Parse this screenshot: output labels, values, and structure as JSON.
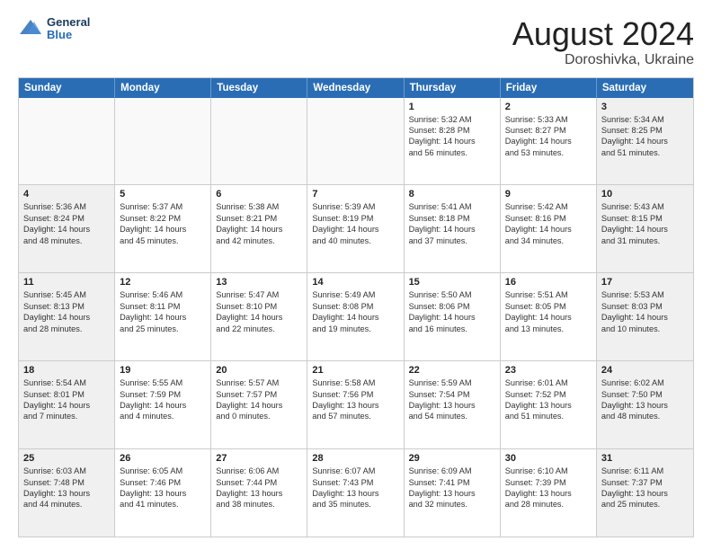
{
  "logo": {
    "text1": "General",
    "text2": "Blue"
  },
  "title": "August 2024",
  "subtitle": "Doroshivka, Ukraine",
  "header_days": [
    "Sunday",
    "Monday",
    "Tuesday",
    "Wednesday",
    "Thursday",
    "Friday",
    "Saturday"
  ],
  "rows": [
    [
      {
        "day": "",
        "lines": [],
        "empty": true
      },
      {
        "day": "",
        "lines": [],
        "empty": true
      },
      {
        "day": "",
        "lines": [],
        "empty": true
      },
      {
        "day": "",
        "lines": [],
        "empty": true
      },
      {
        "day": "1",
        "lines": [
          "Sunrise: 5:32 AM",
          "Sunset: 8:28 PM",
          "Daylight: 14 hours",
          "and 56 minutes."
        ],
        "empty": false
      },
      {
        "day": "2",
        "lines": [
          "Sunrise: 5:33 AM",
          "Sunset: 8:27 PM",
          "Daylight: 14 hours",
          "and 53 minutes."
        ],
        "empty": false
      },
      {
        "day": "3",
        "lines": [
          "Sunrise: 5:34 AM",
          "Sunset: 8:25 PM",
          "Daylight: 14 hours",
          "and 51 minutes."
        ],
        "empty": false
      }
    ],
    [
      {
        "day": "4",
        "lines": [
          "Sunrise: 5:36 AM",
          "Sunset: 8:24 PM",
          "Daylight: 14 hours",
          "and 48 minutes."
        ],
        "empty": false
      },
      {
        "day": "5",
        "lines": [
          "Sunrise: 5:37 AM",
          "Sunset: 8:22 PM",
          "Daylight: 14 hours",
          "and 45 minutes."
        ],
        "empty": false
      },
      {
        "day": "6",
        "lines": [
          "Sunrise: 5:38 AM",
          "Sunset: 8:21 PM",
          "Daylight: 14 hours",
          "and 42 minutes."
        ],
        "empty": false
      },
      {
        "day": "7",
        "lines": [
          "Sunrise: 5:39 AM",
          "Sunset: 8:19 PM",
          "Daylight: 14 hours",
          "and 40 minutes."
        ],
        "empty": false
      },
      {
        "day": "8",
        "lines": [
          "Sunrise: 5:41 AM",
          "Sunset: 8:18 PM",
          "Daylight: 14 hours",
          "and 37 minutes."
        ],
        "empty": false
      },
      {
        "day": "9",
        "lines": [
          "Sunrise: 5:42 AM",
          "Sunset: 8:16 PM",
          "Daylight: 14 hours",
          "and 34 minutes."
        ],
        "empty": false
      },
      {
        "day": "10",
        "lines": [
          "Sunrise: 5:43 AM",
          "Sunset: 8:15 PM",
          "Daylight: 14 hours",
          "and 31 minutes."
        ],
        "empty": false
      }
    ],
    [
      {
        "day": "11",
        "lines": [
          "Sunrise: 5:45 AM",
          "Sunset: 8:13 PM",
          "Daylight: 14 hours",
          "and 28 minutes."
        ],
        "empty": false
      },
      {
        "day": "12",
        "lines": [
          "Sunrise: 5:46 AM",
          "Sunset: 8:11 PM",
          "Daylight: 14 hours",
          "and 25 minutes."
        ],
        "empty": false
      },
      {
        "day": "13",
        "lines": [
          "Sunrise: 5:47 AM",
          "Sunset: 8:10 PM",
          "Daylight: 14 hours",
          "and 22 minutes."
        ],
        "empty": false
      },
      {
        "day": "14",
        "lines": [
          "Sunrise: 5:49 AM",
          "Sunset: 8:08 PM",
          "Daylight: 14 hours",
          "and 19 minutes."
        ],
        "empty": false
      },
      {
        "day": "15",
        "lines": [
          "Sunrise: 5:50 AM",
          "Sunset: 8:06 PM",
          "Daylight: 14 hours",
          "and 16 minutes."
        ],
        "empty": false
      },
      {
        "day": "16",
        "lines": [
          "Sunrise: 5:51 AM",
          "Sunset: 8:05 PM",
          "Daylight: 14 hours",
          "and 13 minutes."
        ],
        "empty": false
      },
      {
        "day": "17",
        "lines": [
          "Sunrise: 5:53 AM",
          "Sunset: 8:03 PM",
          "Daylight: 14 hours",
          "and 10 minutes."
        ],
        "empty": false
      }
    ],
    [
      {
        "day": "18",
        "lines": [
          "Sunrise: 5:54 AM",
          "Sunset: 8:01 PM",
          "Daylight: 14 hours",
          "and 7 minutes."
        ],
        "empty": false
      },
      {
        "day": "19",
        "lines": [
          "Sunrise: 5:55 AM",
          "Sunset: 7:59 PM",
          "Daylight: 14 hours",
          "and 4 minutes."
        ],
        "empty": false
      },
      {
        "day": "20",
        "lines": [
          "Sunrise: 5:57 AM",
          "Sunset: 7:57 PM",
          "Daylight: 14 hours",
          "and 0 minutes."
        ],
        "empty": false
      },
      {
        "day": "21",
        "lines": [
          "Sunrise: 5:58 AM",
          "Sunset: 7:56 PM",
          "Daylight: 13 hours",
          "and 57 minutes."
        ],
        "empty": false
      },
      {
        "day": "22",
        "lines": [
          "Sunrise: 5:59 AM",
          "Sunset: 7:54 PM",
          "Daylight: 13 hours",
          "and 54 minutes."
        ],
        "empty": false
      },
      {
        "day": "23",
        "lines": [
          "Sunrise: 6:01 AM",
          "Sunset: 7:52 PM",
          "Daylight: 13 hours",
          "and 51 minutes."
        ],
        "empty": false
      },
      {
        "day": "24",
        "lines": [
          "Sunrise: 6:02 AM",
          "Sunset: 7:50 PM",
          "Daylight: 13 hours",
          "and 48 minutes."
        ],
        "empty": false
      }
    ],
    [
      {
        "day": "25",
        "lines": [
          "Sunrise: 6:03 AM",
          "Sunset: 7:48 PM",
          "Daylight: 13 hours",
          "and 44 minutes."
        ],
        "empty": false
      },
      {
        "day": "26",
        "lines": [
          "Sunrise: 6:05 AM",
          "Sunset: 7:46 PM",
          "Daylight: 13 hours",
          "and 41 minutes."
        ],
        "empty": false
      },
      {
        "day": "27",
        "lines": [
          "Sunrise: 6:06 AM",
          "Sunset: 7:44 PM",
          "Daylight: 13 hours",
          "and 38 minutes."
        ],
        "empty": false
      },
      {
        "day": "28",
        "lines": [
          "Sunrise: 6:07 AM",
          "Sunset: 7:43 PM",
          "Daylight: 13 hours",
          "and 35 minutes."
        ],
        "empty": false
      },
      {
        "day": "29",
        "lines": [
          "Sunrise: 6:09 AM",
          "Sunset: 7:41 PM",
          "Daylight: 13 hours",
          "and 32 minutes."
        ],
        "empty": false
      },
      {
        "day": "30",
        "lines": [
          "Sunrise: 6:10 AM",
          "Sunset: 7:39 PM",
          "Daylight: 13 hours",
          "and 28 minutes."
        ],
        "empty": false
      },
      {
        "day": "31",
        "lines": [
          "Sunrise: 6:11 AM",
          "Sunset: 7:37 PM",
          "Daylight: 13 hours",
          "and 25 minutes."
        ],
        "empty": false
      }
    ]
  ]
}
